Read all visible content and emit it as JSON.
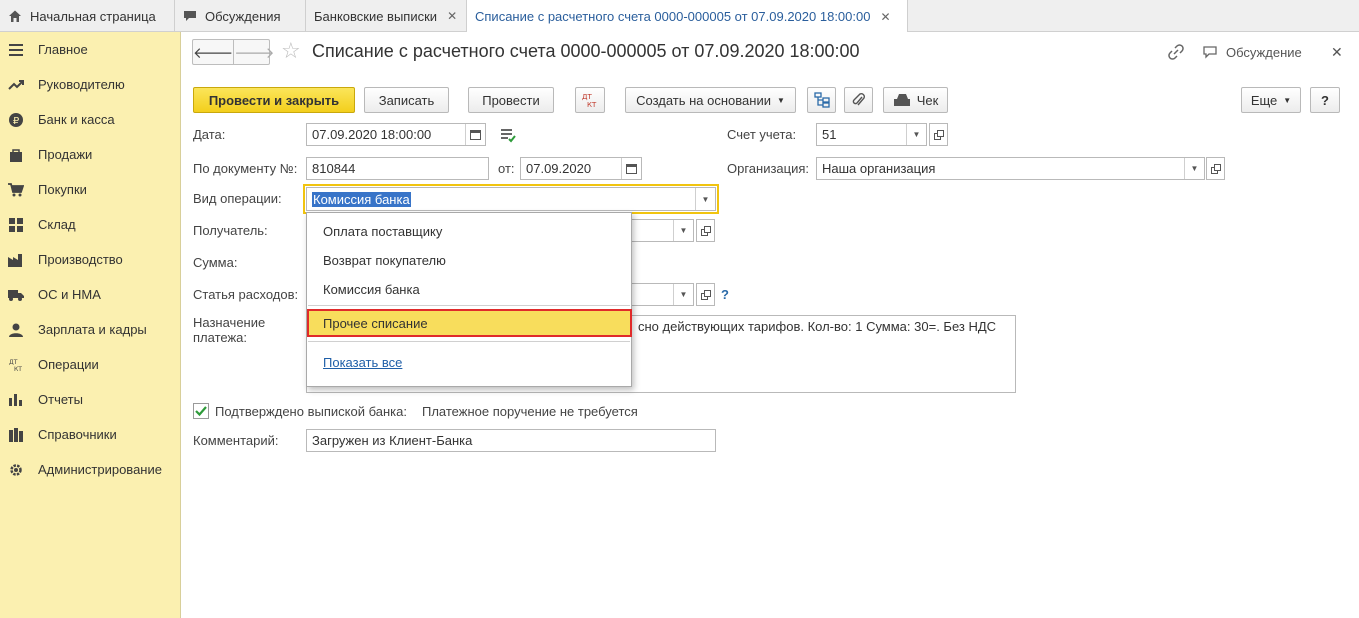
{
  "tabs": [
    {
      "label": "Начальная страница",
      "icon": "home-icon"
    },
    {
      "label": "Обсуждения",
      "icon": "chat-icon"
    },
    {
      "label": "Банковские выписки",
      "close": "✕"
    },
    {
      "label": "Списание с расчетного счета 0000-000005 от 07.09.2020 18:00:00",
      "close": "✕"
    }
  ],
  "sidebar": {
    "items": [
      {
        "label": "Главное",
        "icon": "menu-icon"
      },
      {
        "label": "Руководителю",
        "icon": "trend-icon"
      },
      {
        "label": "Банк и касса",
        "icon": "ruble-icon"
      },
      {
        "label": "Продажи",
        "icon": "bag-icon"
      },
      {
        "label": "Покупки",
        "icon": "cart-icon"
      },
      {
        "label": "Склад",
        "icon": "warehouse-icon"
      },
      {
        "label": "Производство",
        "icon": "factory-icon"
      },
      {
        "label": "ОС и НМА",
        "icon": "truck-icon"
      },
      {
        "label": "Зарплата и кадры",
        "icon": "person-icon"
      },
      {
        "label": "Операции",
        "icon": "dt-kt-icon"
      },
      {
        "label": "Отчеты",
        "icon": "bar-chart-icon"
      },
      {
        "label": "Справочники",
        "icon": "books-icon"
      },
      {
        "label": "Администрирование",
        "icon": "gear-icon"
      }
    ]
  },
  "header": {
    "title": "Списание с расчетного счета 0000-000005 от 07.09.2020 18:00:00",
    "discussion_label": "Обсуждение",
    "close": "✕"
  },
  "toolbar": {
    "post_close": "Провести и закрыть",
    "save": "Записать",
    "post": "Провести",
    "dtkt": "Дт Кт",
    "create_based": "Создать на основании",
    "check": "Чек",
    "more": "Еще",
    "help": "?"
  },
  "form": {
    "date_label": "Дата:",
    "date_value": "07.09.2020 18:00:00",
    "account_label": "Счет учета:",
    "account_value": "51",
    "doc_num_label": "По документу №:",
    "doc_num_value": "810844",
    "from_label": "от:",
    "from_value": "07.09.2020",
    "org_label": "Организация:",
    "org_value": "Наша организация",
    "op_type_label": "Вид операции:",
    "op_type_value": "Комиссия банка",
    "recipient_label": "Получатель:",
    "sum_label": "Сумма:",
    "expense_label": "Статья расходов:",
    "expense_help": "?",
    "purpose_label_1": "Назначение",
    "purpose_label_2": "платежа:",
    "purpose_value": "сно действующих тарифов.  Кол-во: 1 Сумма: 30=. Без НДС",
    "confirmed_label": "Подтверждено выпиской банка:",
    "confirmed_checked": true,
    "payment_note": "Платежное поручение не требуется",
    "comment_label": "Комментарий:",
    "comment_value": "Загружен из Клиент-Банка"
  },
  "dropdown": {
    "options": [
      "Оплата поставщику",
      "Возврат покупателю",
      "Комиссия банка"
    ],
    "highlighted": "Прочее списание",
    "show_all": "Показать все"
  },
  "colors": {
    "sidebar_bg": "#fbf0b0",
    "primary_button": "#f3cf1c",
    "highlight": "#f8dd5c",
    "highlight_border": "#e02a2a",
    "link": "#1f5fa8"
  }
}
